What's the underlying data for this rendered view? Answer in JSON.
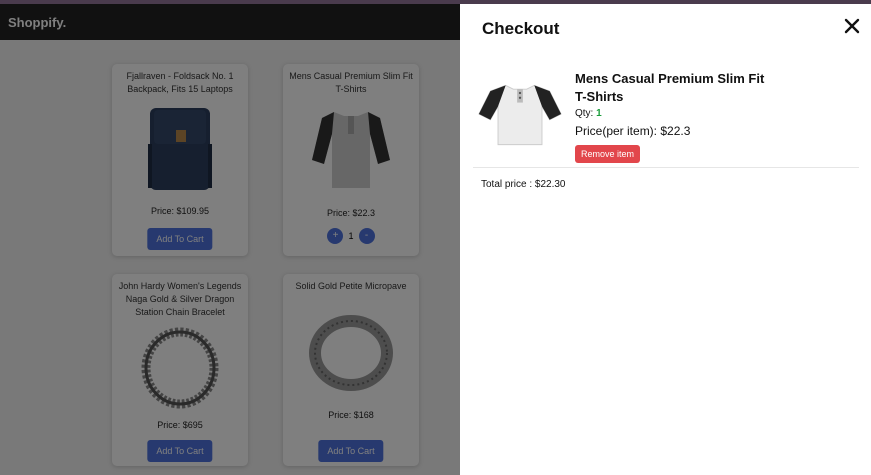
{
  "store": {
    "brand": "Shoppify.",
    "products": [
      {
        "title": "Fjallraven - Foldsack No. 1 Backpack, Fits 15 Laptops",
        "price": "Price: $109.95",
        "button": "Add To Cart",
        "image": "backpack-image"
      },
      {
        "title": "Mens Casual Premium Slim Fit T-Shirts",
        "price": "Price: $22.3",
        "qty": "1",
        "plus": "+",
        "minus": "-",
        "image": "tshirt-image"
      },
      {
        "title": "John Hardy Women's Legends Naga Gold & Silver Dragon Station Chain Bracelet",
        "price": "Price: $695",
        "button": "Add To Cart",
        "image": "bracelet-image"
      },
      {
        "title": "Solid Gold Petite Micropave",
        "price": "Price: $168",
        "button": "Add To Cart",
        "image": "ring-image"
      }
    ]
  },
  "checkout": {
    "title": "Checkout",
    "close_icon": "close-icon",
    "item": {
      "name": "Mens Casual Premium Slim Fit T-Shirts",
      "qty_label": "Qty:",
      "qty": "1",
      "price_per_item": "Price(per item): $22.3",
      "remove_label": "Remove item"
    },
    "total": "Total price : $22.30"
  },
  "colors": {
    "accent": "#4e73df",
    "remove": "#e2464b",
    "header": "#222222",
    "qty_green": "#1a9c3b"
  }
}
